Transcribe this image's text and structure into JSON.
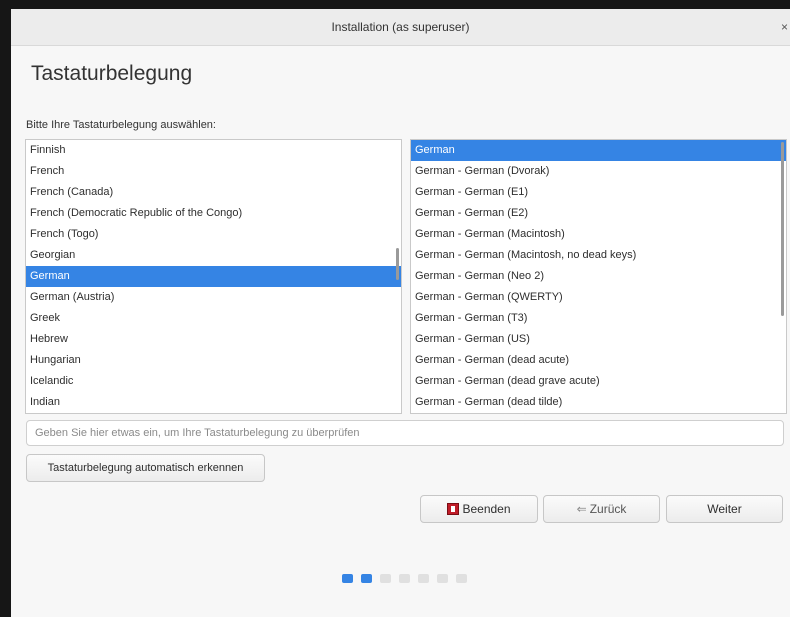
{
  "window": {
    "title": "Installation (as superuser)",
    "close_glyph": "×"
  },
  "page": {
    "title": "Tastaturbelegung",
    "instruction": "Bitte Ihre Tastaturbelegung auswählen:"
  },
  "layouts": {
    "items": [
      "Finnish",
      "French",
      "French (Canada)",
      "French (Democratic Republic of the Congo)",
      "French (Togo)",
      "Georgian",
      "German",
      "German (Austria)",
      "Greek",
      "Hebrew",
      "Hungarian",
      "Icelandic",
      "Indian"
    ],
    "selected": "German"
  },
  "variants": {
    "items": [
      "German",
      "German - German (Dvorak)",
      "German - German (E1)",
      "German - German (E2)",
      "German - German (Macintosh)",
      "German - German (Macintosh, no dead keys)",
      "German - German (Neo 2)",
      "German - German (QWERTY)",
      "German - German (T3)",
      "German - German (US)",
      "German - German (dead acute)",
      "German - German (dead grave acute)",
      "German - German (dead tilde)"
    ],
    "selected": "German"
  },
  "test_field": {
    "placeholder": "Geben Sie hier etwas ein, um Ihre Tastaturbelegung zu überprüfen",
    "value": ""
  },
  "buttons": {
    "detect": "Tastaturbelegung automatisch erkennen",
    "quit": "Beenden",
    "back": "Zurück",
    "next": "Weiter",
    "back_glyph": "⇐"
  },
  "progress": {
    "total_steps": 7,
    "completed_steps": 2
  },
  "colors": {
    "accent": "#3584e4"
  }
}
